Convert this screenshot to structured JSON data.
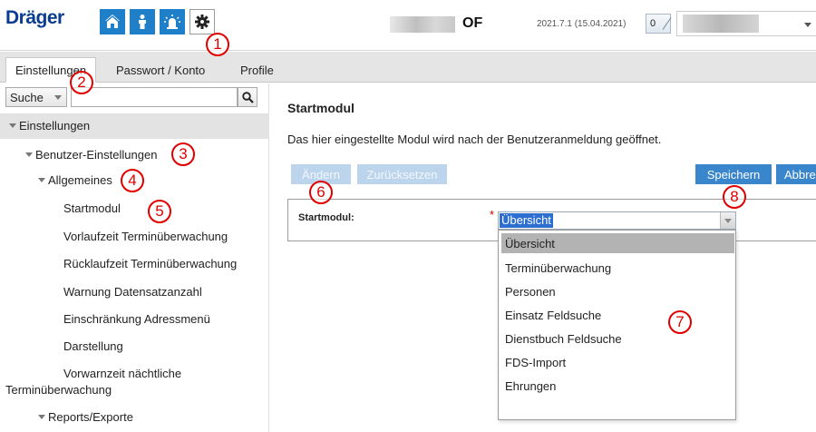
{
  "header": {
    "logo": "Dräger",
    "app_icons": [
      "home-icon",
      "person-icon",
      "alarm-icon",
      "gear-icon"
    ],
    "org_name": "OF",
    "version": "2021.7.1 (15.04.2021)",
    "counter": "0"
  },
  "tabs": [
    "Einstellungen",
    "Passwort / Konto",
    "Profile"
  ],
  "sidebar": {
    "search_select": "Suche",
    "search_placeholder": "",
    "tree": [
      "Einstellungen",
      "Benutzer-Einstellungen",
      "Allgemeines",
      "Startmodul",
      "Vorlaufzeit Terminüberwachung",
      "Rücklaufzeit Terminüberwachung",
      "Warnung Datensatzanzahl",
      "Einschränkung Adressmenü",
      "Darstellung",
      "Vorwarnzeit nächtliche",
      "Terminüberwachung",
      "Reports/Exporte"
    ]
  },
  "main": {
    "title": "Startmodul",
    "description": "Das hier eingestellte Modul wird nach der Benutzeranmeldung geöffnet.",
    "buttons": {
      "edit": "Ändern",
      "reset": "Zurücksetzen",
      "save": "Speichern",
      "cancel": "Abbrechen"
    },
    "form": {
      "label": "Startmodul:",
      "required_mark": "*",
      "value": "Übersicht",
      "options": [
        "Übersicht",
        "Terminüberwachung",
        "Personen",
        "Einsatz Feldsuche",
        "Dienstbuch Feldsuche",
        "FDS-Import",
        "Ehrungen"
      ]
    }
  },
  "callouts": [
    "1",
    "2",
    "3",
    "4",
    "5",
    "6",
    "7",
    "8"
  ],
  "colors": {
    "brand": "#0a3d91",
    "accent": "#1f80c9",
    "primary_button": "#3a86cc",
    "annotation": "#e00000"
  }
}
